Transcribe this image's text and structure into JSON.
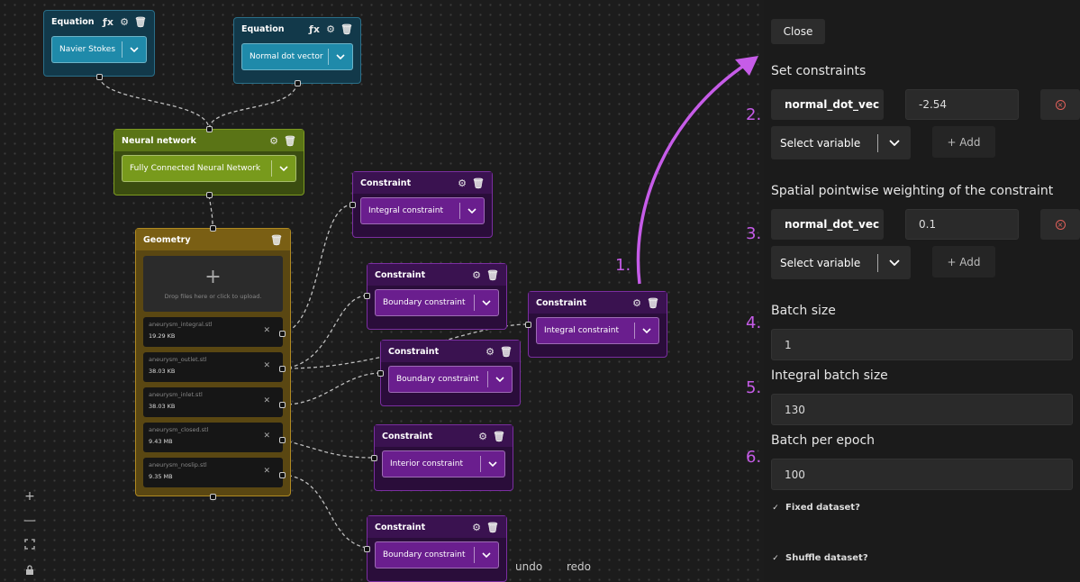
{
  "colors": {
    "annotation": "#c65ce8",
    "equation": "#1f8aaa",
    "neural_network": "#789a1c",
    "geometry": "#b08a22",
    "constraint": "#6a1e8e",
    "remove": "#e0605a"
  },
  "canvas": {
    "equations": [
      {
        "title": "Equation",
        "value": "Navier Stokes",
        "icons": [
          "fx-icon",
          "gear-icon",
          "trash-icon"
        ]
      },
      {
        "title": "Equation",
        "value": "Normal dot vector",
        "icons": [
          "fx-icon",
          "gear-icon",
          "trash-icon"
        ]
      }
    ],
    "neural_network": {
      "title": "Neural network",
      "value": "Fully Connected Neural Network"
    },
    "geometry": {
      "title": "Geometry",
      "drop_text": "Drop files here or click to upload.",
      "files": [
        {
          "name": "aneurysm_integral.stl",
          "size": "19.29 KB"
        },
        {
          "name": "aneurysm_outlet.stl",
          "size": "38.03 KB"
        },
        {
          "name": "aneurysm_inlet.stl",
          "size": "38.03 KB"
        },
        {
          "name": "aneurysm_closed.stl",
          "size": "9.43 MB"
        },
        {
          "name": "aneurysm_noslip.stl",
          "size": "9.35 MB"
        }
      ]
    },
    "constraints": [
      {
        "title": "Constraint",
        "value": "Integral constraint"
      },
      {
        "title": "Constraint",
        "value": "Boundary constraint"
      },
      {
        "title": "Constraint",
        "value": "Integral constraint"
      },
      {
        "title": "Constraint",
        "value": "Boundary constraint"
      },
      {
        "title": "Constraint",
        "value": "Interior constraint"
      },
      {
        "title": "Constraint",
        "value": "Boundary constraint"
      }
    ],
    "undo_label": "undo",
    "redo_label": "redo"
  },
  "annotations": [
    "1.",
    "2.",
    "3.",
    "4.",
    "5.",
    "6."
  ],
  "panel": {
    "close_label": "Close",
    "set_constraints": {
      "heading": "Set constraints",
      "variable": "normal_dot_vec",
      "value": "-2.54",
      "select_placeholder": "Select variable",
      "add_label": "+ Add"
    },
    "spatial_weighting": {
      "heading": "Spatial pointwise weighting of the constraint",
      "variable": "normal_dot_vec",
      "value": "0.1",
      "select_placeholder": "Select variable",
      "add_label": "+ Add"
    },
    "batch_size": {
      "label": "Batch size",
      "value": "1"
    },
    "integral_batch_size": {
      "label": "Integral batch size",
      "value": "130"
    },
    "batch_per_epoch": {
      "label": "Batch per epoch",
      "value": "100"
    },
    "fixed_dataset": {
      "label": "Fixed dataset?",
      "checked": true
    },
    "shuffle_dataset": {
      "label": "Shuffle dataset?",
      "checked": true
    }
  }
}
